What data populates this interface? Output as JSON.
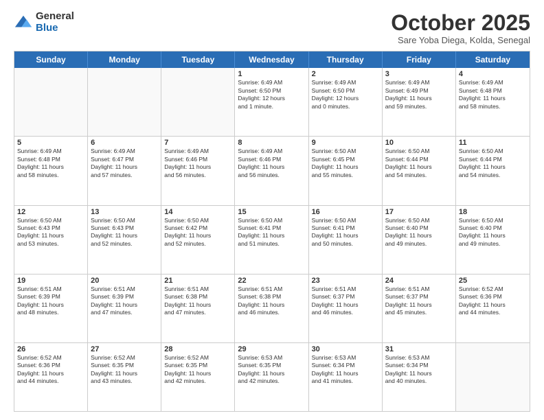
{
  "logo": {
    "general": "General",
    "blue": "Blue"
  },
  "header": {
    "month": "October 2025",
    "location": "Sare Yoba Diega, Kolda, Senegal"
  },
  "dayHeaders": [
    "Sunday",
    "Monday",
    "Tuesday",
    "Wednesday",
    "Thursday",
    "Friday",
    "Saturday"
  ],
  "weeks": [
    [
      {
        "day": "",
        "info": ""
      },
      {
        "day": "",
        "info": ""
      },
      {
        "day": "",
        "info": ""
      },
      {
        "day": "1",
        "info": "Sunrise: 6:49 AM\nSunset: 6:50 PM\nDaylight: 12 hours\nand 1 minute."
      },
      {
        "day": "2",
        "info": "Sunrise: 6:49 AM\nSunset: 6:50 PM\nDaylight: 12 hours\nand 0 minutes."
      },
      {
        "day": "3",
        "info": "Sunrise: 6:49 AM\nSunset: 6:49 PM\nDaylight: 11 hours\nand 59 minutes."
      },
      {
        "day": "4",
        "info": "Sunrise: 6:49 AM\nSunset: 6:48 PM\nDaylight: 11 hours\nand 58 minutes."
      }
    ],
    [
      {
        "day": "5",
        "info": "Sunrise: 6:49 AM\nSunset: 6:48 PM\nDaylight: 11 hours\nand 58 minutes."
      },
      {
        "day": "6",
        "info": "Sunrise: 6:49 AM\nSunset: 6:47 PM\nDaylight: 11 hours\nand 57 minutes."
      },
      {
        "day": "7",
        "info": "Sunrise: 6:49 AM\nSunset: 6:46 PM\nDaylight: 11 hours\nand 56 minutes."
      },
      {
        "day": "8",
        "info": "Sunrise: 6:49 AM\nSunset: 6:46 PM\nDaylight: 11 hours\nand 56 minutes."
      },
      {
        "day": "9",
        "info": "Sunrise: 6:50 AM\nSunset: 6:45 PM\nDaylight: 11 hours\nand 55 minutes."
      },
      {
        "day": "10",
        "info": "Sunrise: 6:50 AM\nSunset: 6:44 PM\nDaylight: 11 hours\nand 54 minutes."
      },
      {
        "day": "11",
        "info": "Sunrise: 6:50 AM\nSunset: 6:44 PM\nDaylight: 11 hours\nand 54 minutes."
      }
    ],
    [
      {
        "day": "12",
        "info": "Sunrise: 6:50 AM\nSunset: 6:43 PM\nDaylight: 11 hours\nand 53 minutes."
      },
      {
        "day": "13",
        "info": "Sunrise: 6:50 AM\nSunset: 6:43 PM\nDaylight: 11 hours\nand 52 minutes."
      },
      {
        "day": "14",
        "info": "Sunrise: 6:50 AM\nSunset: 6:42 PM\nDaylight: 11 hours\nand 52 minutes."
      },
      {
        "day": "15",
        "info": "Sunrise: 6:50 AM\nSunset: 6:41 PM\nDaylight: 11 hours\nand 51 minutes."
      },
      {
        "day": "16",
        "info": "Sunrise: 6:50 AM\nSunset: 6:41 PM\nDaylight: 11 hours\nand 50 minutes."
      },
      {
        "day": "17",
        "info": "Sunrise: 6:50 AM\nSunset: 6:40 PM\nDaylight: 11 hours\nand 49 minutes."
      },
      {
        "day": "18",
        "info": "Sunrise: 6:50 AM\nSunset: 6:40 PM\nDaylight: 11 hours\nand 49 minutes."
      }
    ],
    [
      {
        "day": "19",
        "info": "Sunrise: 6:51 AM\nSunset: 6:39 PM\nDaylight: 11 hours\nand 48 minutes."
      },
      {
        "day": "20",
        "info": "Sunrise: 6:51 AM\nSunset: 6:39 PM\nDaylight: 11 hours\nand 47 minutes."
      },
      {
        "day": "21",
        "info": "Sunrise: 6:51 AM\nSunset: 6:38 PM\nDaylight: 11 hours\nand 47 minutes."
      },
      {
        "day": "22",
        "info": "Sunrise: 6:51 AM\nSunset: 6:38 PM\nDaylight: 11 hours\nand 46 minutes."
      },
      {
        "day": "23",
        "info": "Sunrise: 6:51 AM\nSunset: 6:37 PM\nDaylight: 11 hours\nand 46 minutes."
      },
      {
        "day": "24",
        "info": "Sunrise: 6:51 AM\nSunset: 6:37 PM\nDaylight: 11 hours\nand 45 minutes."
      },
      {
        "day": "25",
        "info": "Sunrise: 6:52 AM\nSunset: 6:36 PM\nDaylight: 11 hours\nand 44 minutes."
      }
    ],
    [
      {
        "day": "26",
        "info": "Sunrise: 6:52 AM\nSunset: 6:36 PM\nDaylight: 11 hours\nand 44 minutes."
      },
      {
        "day": "27",
        "info": "Sunrise: 6:52 AM\nSunset: 6:35 PM\nDaylight: 11 hours\nand 43 minutes."
      },
      {
        "day": "28",
        "info": "Sunrise: 6:52 AM\nSunset: 6:35 PM\nDaylight: 11 hours\nand 42 minutes."
      },
      {
        "day": "29",
        "info": "Sunrise: 6:53 AM\nSunset: 6:35 PM\nDaylight: 11 hours\nand 42 minutes."
      },
      {
        "day": "30",
        "info": "Sunrise: 6:53 AM\nSunset: 6:34 PM\nDaylight: 11 hours\nand 41 minutes."
      },
      {
        "day": "31",
        "info": "Sunrise: 6:53 AM\nSunset: 6:34 PM\nDaylight: 11 hours\nand 40 minutes."
      },
      {
        "day": "",
        "info": ""
      }
    ]
  ]
}
